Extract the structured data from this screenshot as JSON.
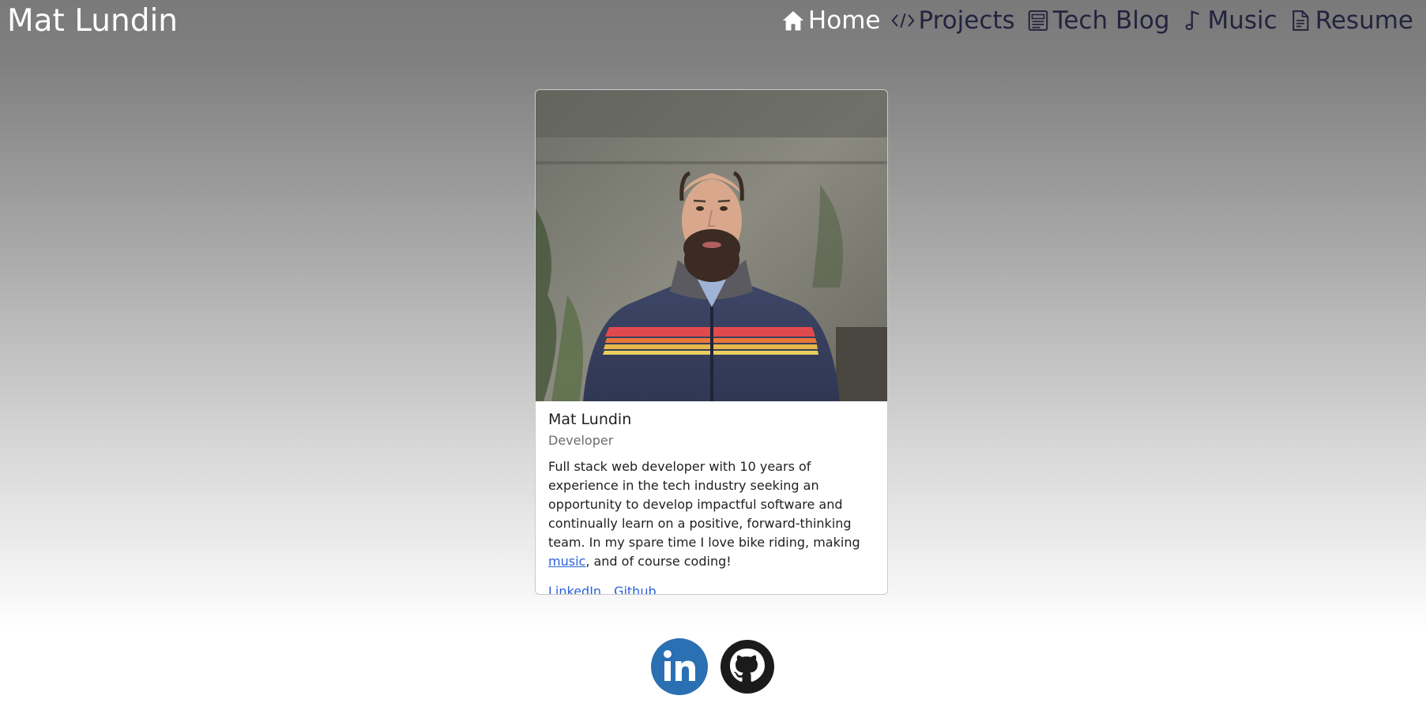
{
  "header": {
    "brand": "Mat Lundin",
    "nav": [
      {
        "label": "Home",
        "icon": "home-icon",
        "active": true
      },
      {
        "label": "Projects",
        "icon": "code-icon",
        "active": false
      },
      {
        "label": "Tech Blog",
        "icon": "newspaper-icon",
        "active": false
      },
      {
        "label": "Music",
        "icon": "music-note-icon",
        "active": false
      },
      {
        "label": "Resume",
        "icon": "document-icon",
        "active": false
      }
    ]
  },
  "profile": {
    "name": "Mat Lundin",
    "role": "Developer",
    "bio_before": "Full stack web developer with 10 years of experience in the tech industry seeking an opportunity to develop impactful software and continually learn on a positive, forward-thinking team. In my spare time I love bike riding, making ",
    "bio_link": "music",
    "bio_after": ", and of course coding!",
    "links": {
      "linkedin": "LinkedIn",
      "github": "Github"
    }
  },
  "social": {
    "icons": [
      "linkedin-icon",
      "github-icon"
    ],
    "linkedin_color": "#2a70b3",
    "github_color": "#1b1b1b"
  },
  "colors": {
    "link": "#2b62d9",
    "nav_text": "#23233f",
    "nav_active": "#ffffff"
  }
}
